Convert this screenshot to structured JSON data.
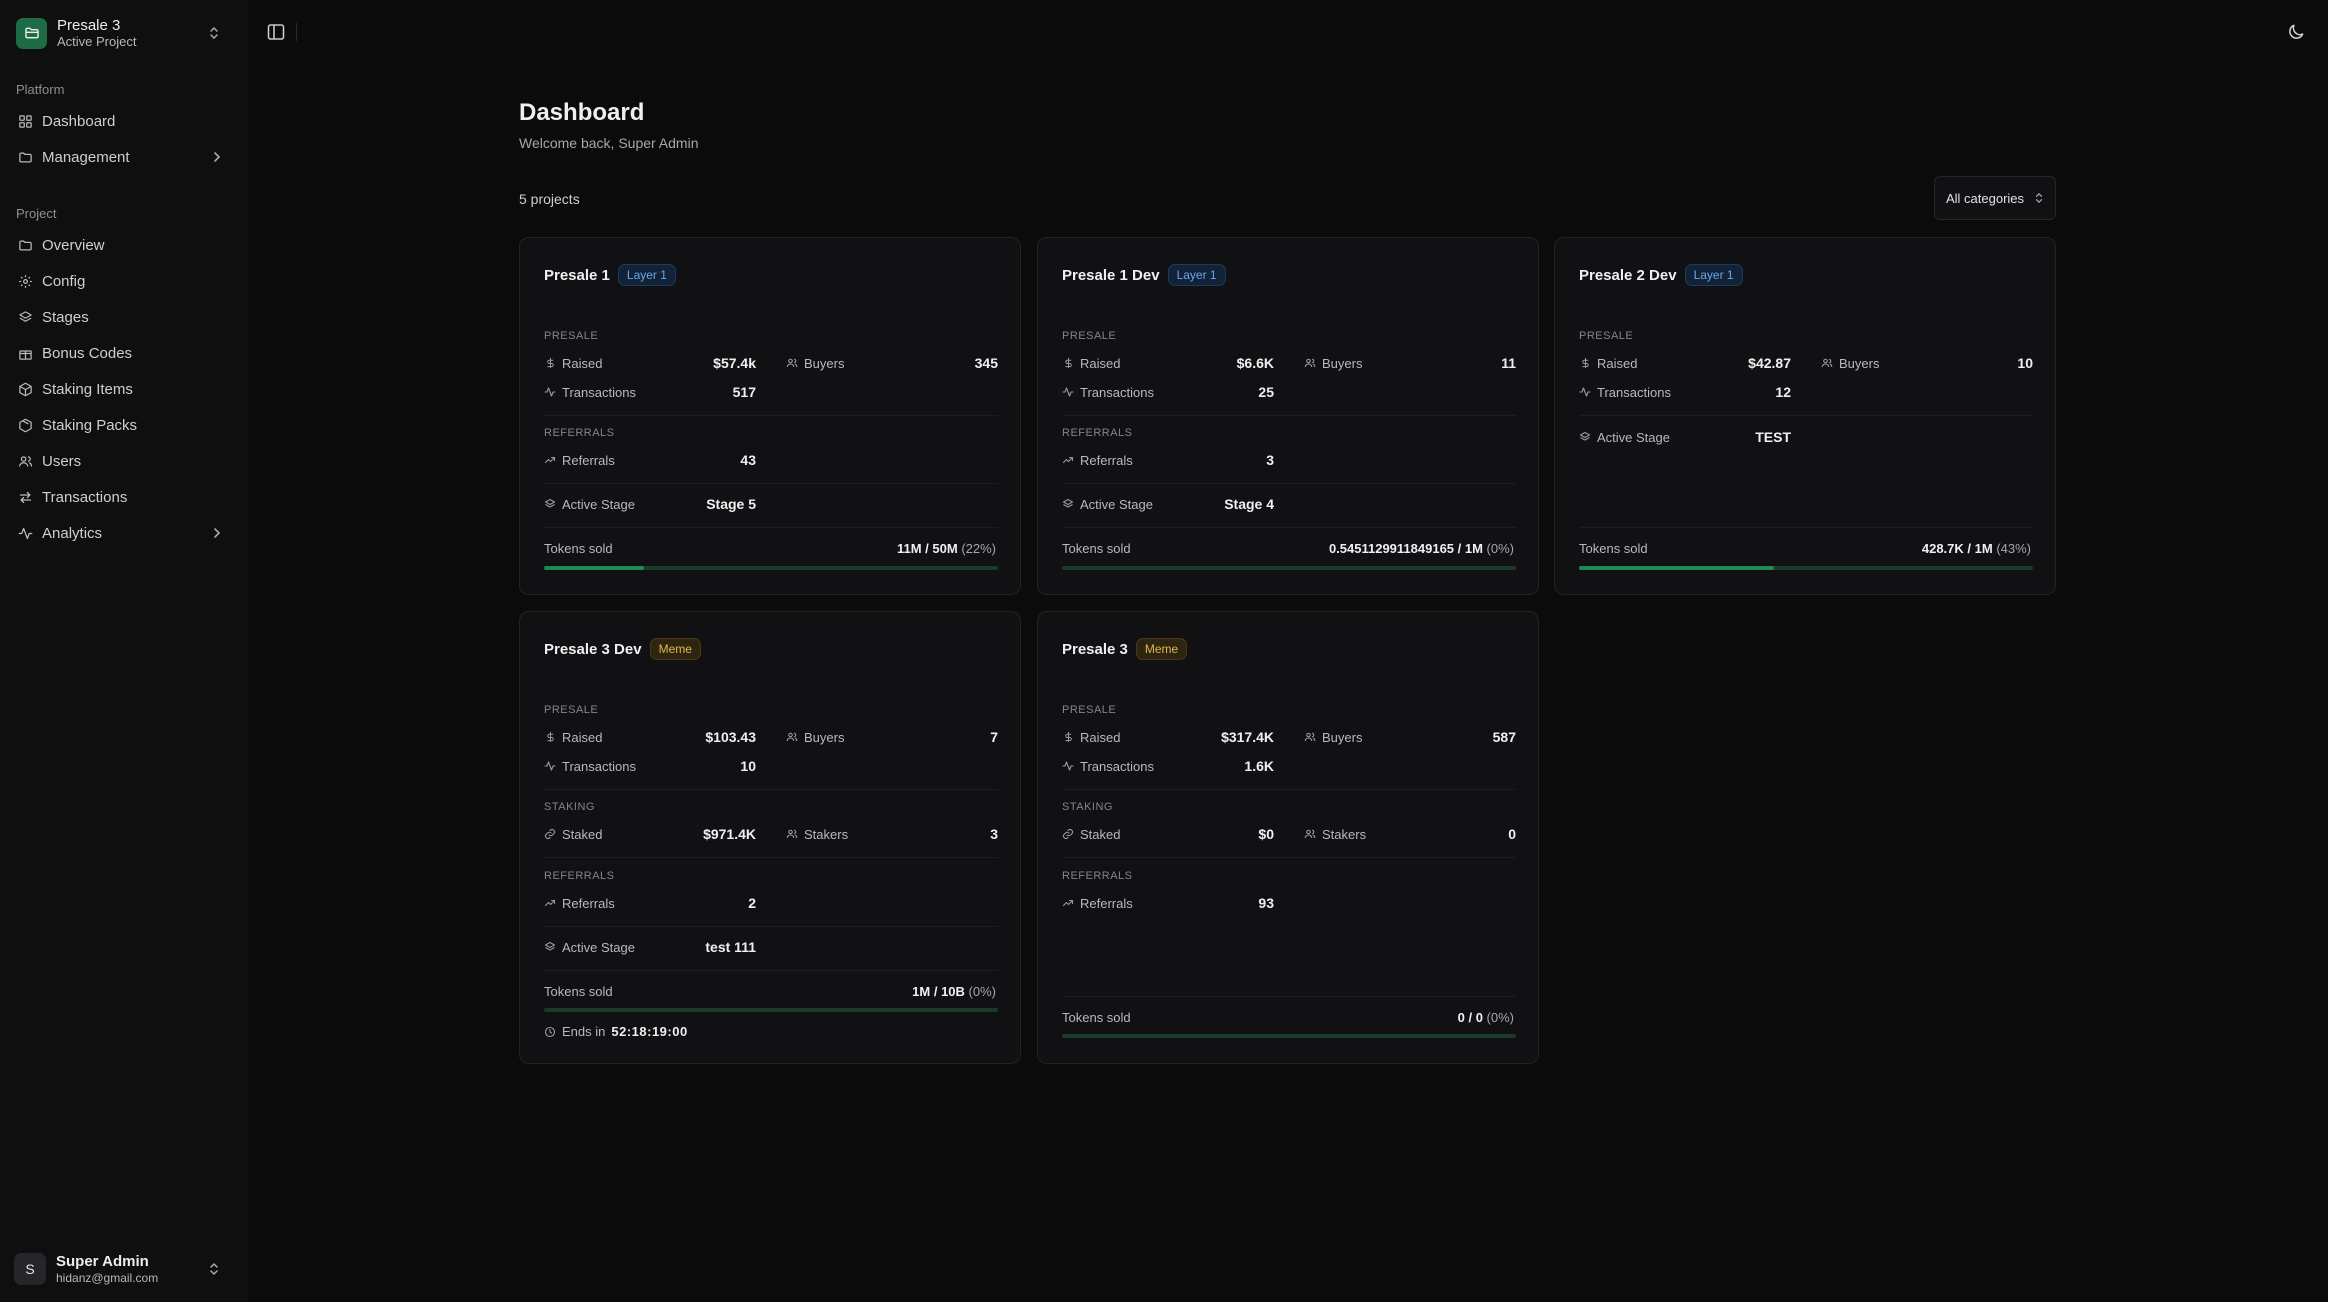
{
  "project_switcher": {
    "name": "Presale 3",
    "subtitle": "Active Project"
  },
  "sidebar": {
    "platform_label": "Platform",
    "platform_items": [
      {
        "label": "Dashboard",
        "icon": "dashboard-icon"
      },
      {
        "label": "Management",
        "icon": "folder-icon",
        "expandable": true
      }
    ],
    "project_label": "Project",
    "project_items": [
      {
        "label": "Overview",
        "icon": "folder-icon"
      },
      {
        "label": "Config",
        "icon": "gear-icon"
      },
      {
        "label": "Stages",
        "icon": "layers-icon"
      },
      {
        "label": "Bonus Codes",
        "icon": "gift-icon"
      },
      {
        "label": "Staking Items",
        "icon": "cube-icon"
      },
      {
        "label": "Staking Packs",
        "icon": "package-icon"
      },
      {
        "label": "Users",
        "icon": "users-icon"
      },
      {
        "label": "Transactions",
        "icon": "arrows-icon"
      },
      {
        "label": "Analytics",
        "icon": "activity-icon",
        "expandable": true
      }
    ]
  },
  "user": {
    "initial": "S",
    "name": "Super Admin",
    "email": "hidanz@gmail.com"
  },
  "header": {
    "title": "Dashboard",
    "subtitle": "Welcome back, Super Admin"
  },
  "toolbar": {
    "count": "5 projects",
    "category": "All categories"
  },
  "cards": [
    {
      "name": "Presale 1",
      "badge": "Layer 1",
      "presale_label": "PRESALE",
      "raised_label": "Raised",
      "raised": "$57.4k",
      "buyers_label": "Buyers",
      "buyers": "345",
      "tx_label": "Transactions",
      "tx": "517",
      "referrals_section": "REFERRALS",
      "referrals_label": "Referrals",
      "referrals": "43",
      "stage_label": "Active Stage",
      "stage": "Stage 5",
      "tokens_label": "Tokens sold",
      "tokens": "11M / 50M",
      "tokens_pct": "(22%)",
      "progress": 0.22
    },
    {
      "name": "Presale 1 Dev",
      "badge": "Layer 1",
      "presale_label": "PRESALE",
      "raised_label": "Raised",
      "raised": "$6.6K",
      "buyers_label": "Buyers",
      "buyers": "11",
      "tx_label": "Transactions",
      "tx": "25",
      "referrals_section": "REFERRALS",
      "referrals_label": "Referrals",
      "referrals": "3",
      "stage_label": "Active Stage",
      "stage": "Stage 4",
      "tokens_label": "Tokens sold",
      "tokens": "0.5451129911849165 / 1M",
      "tokens_pct": "(0%)",
      "progress": 0.0
    },
    {
      "name": "Presale 2 Dev",
      "badge": "Layer 1",
      "presale_label": "PRESALE",
      "raised_label": "Raised",
      "raised": "$42.87",
      "buyers_label": "Buyers",
      "buyers": "10",
      "tx_label": "Transactions",
      "tx": "12",
      "stage_label": "Active Stage",
      "stage": "TEST",
      "tokens_label": "Tokens sold",
      "tokens": "428.7K / 1M",
      "tokens_pct": "(43%)",
      "progress": 0.43
    },
    {
      "name": "Presale 3 Dev",
      "badge": "Meme",
      "presale_label": "PRESALE",
      "raised_label": "Raised",
      "raised": "$103.43",
      "buyers_label": "Buyers",
      "buyers": "7",
      "tx_label": "Transactions",
      "tx": "10",
      "staking_section": "STAKING",
      "staked_label": "Staked",
      "staked": "$971.4K",
      "stakers_label": "Stakers",
      "stakers": "3",
      "referrals_section": "REFERRALS",
      "referrals_label": "Referrals",
      "referrals": "2",
      "stage_label": "Active Stage",
      "stage": "test 111",
      "tokens_label": "Tokens sold",
      "tokens": "1M / 10B",
      "tokens_pct": "(0%)",
      "progress": 0.0,
      "ends_label": "Ends in",
      "ends": "52:18:19:00"
    },
    {
      "name": "Presale 3",
      "badge": "Meme",
      "presale_label": "PRESALE",
      "raised_label": "Raised",
      "raised": "$317.4K",
      "buyers_label": "Buyers",
      "buyers": "587",
      "tx_label": "Transactions",
      "tx": "1.6K",
      "staking_section": "STAKING",
      "staked_label": "Staked",
      "staked": "$0",
      "stakers_label": "Stakers",
      "stakers": "0",
      "referrals_section": "REFERRALS",
      "referrals_label": "Referrals",
      "referrals": "93",
      "tokens_label": "Tokens sold",
      "tokens": "0 / 0",
      "tokens_pct": "(0%)",
      "progress": 0.0
    }
  ]
}
